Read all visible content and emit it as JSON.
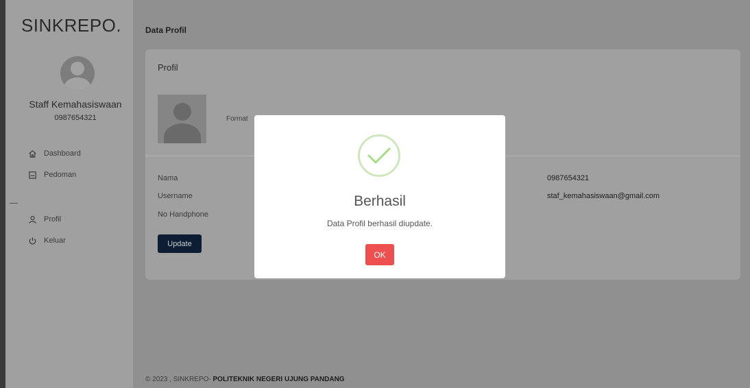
{
  "sidebar": {
    "brand": "SINKREPO.",
    "user": {
      "name": "Staff Kemahasiswaan",
      "id": "0987654321"
    },
    "nav": [
      {
        "label": "Dashboard",
        "icon": "home-icon"
      },
      {
        "label": "Pedoman",
        "icon": "document-icon"
      },
      {
        "label": "Profil",
        "icon": "user-icon"
      },
      {
        "label": "Keluar",
        "icon": "power-icon"
      }
    ]
  },
  "main": {
    "page_title": "Data Profil",
    "card": {
      "title": "Profil",
      "photo_hint": "Format",
      "fields": [
        {
          "label": "Nama",
          "value": "0987654321"
        },
        {
          "label": "Username",
          "value": "staf_kemahasiswaan@gmail.com"
        },
        {
          "label": "No Handphone",
          "value": ""
        }
      ],
      "update_label": "Update"
    },
    "footer": {
      "prefix": "© 2023 , SINKREPO- ",
      "org": "POLITEKNIK NEGERI UJUNG PANDANG"
    }
  },
  "modal": {
    "icon": "success-check-icon",
    "title": "Berhasil",
    "message": "Data Profil berhasil diupdate.",
    "ok_label": "OK"
  },
  "colors": {
    "overlay_sidebar": "#a0a0a0",
    "overlay_main": "#909090",
    "update_button": "#0d1d33",
    "ok_button": "#ee4f4f",
    "success_ring": "#cfe7bd",
    "success_check": "#a5dc86"
  }
}
